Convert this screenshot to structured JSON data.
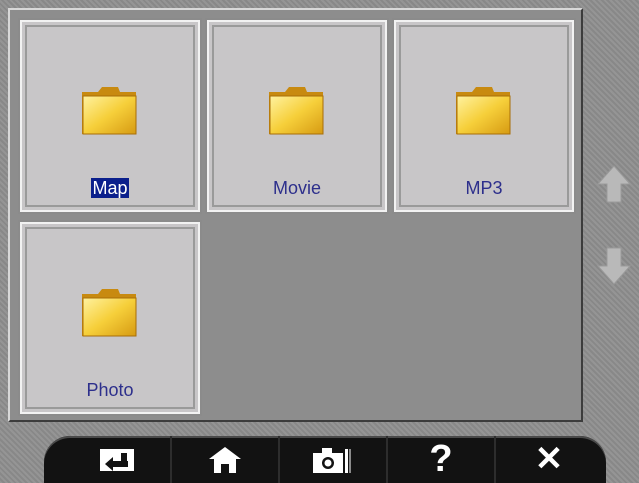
{
  "folders": [
    {
      "label": "Map",
      "selected": true
    },
    {
      "label": "Movie",
      "selected": false
    },
    {
      "label": "MP3",
      "selected": false
    },
    {
      "label": "Photo",
      "selected": false
    }
  ],
  "side_nav": {
    "up_icon": "arrow-up-icon",
    "down_icon": "arrow-down-icon"
  },
  "toolbar": {
    "buttons": [
      {
        "name": "back-button",
        "icon": "back-arrow-icon"
      },
      {
        "name": "home-button",
        "icon": "home-icon"
      },
      {
        "name": "camera-button",
        "icon": "camera-icon"
      },
      {
        "name": "help-button",
        "icon": "help-icon",
        "glyph": "?"
      },
      {
        "name": "close-button",
        "icon": "close-icon",
        "glyph": "✕"
      }
    ]
  },
  "colors": {
    "frame": "#8f8f8f",
    "tile": "#c8c6c8",
    "label_text": "#2d2f8c",
    "selection": "#0b1f8c",
    "toolbar": "#121212",
    "folder_yellow": "#f3c327"
  }
}
